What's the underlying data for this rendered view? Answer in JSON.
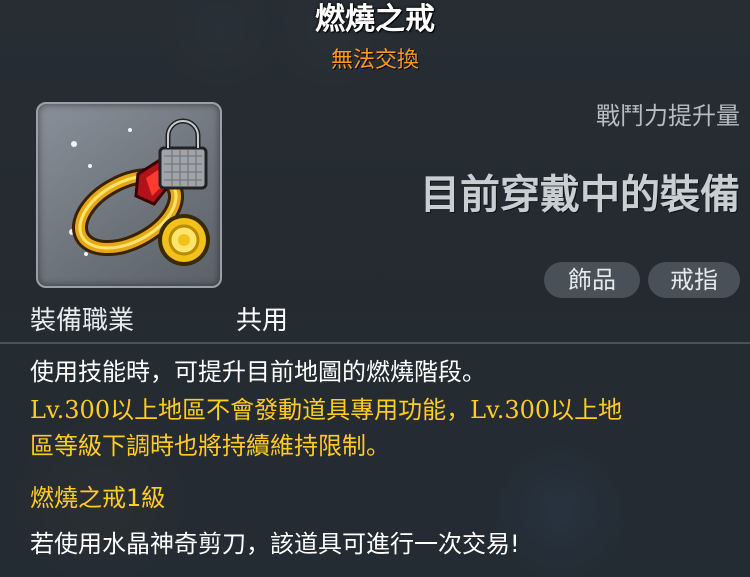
{
  "item": {
    "name": "燃燒之戒",
    "trade_status": "無法交換",
    "icon": "burning-ring-icon",
    "power_label": "戰鬥力提升量",
    "equipped_text": "目前穿戴中的裝備",
    "tags": [
      "飾品",
      "戒指"
    ],
    "job_label": "裝備職業",
    "job_value": "共用",
    "description": "使用技能時，可提升目前地圖的燃燒階段。",
    "notice_line1": "Lv.300以上地區不會發動道具專用功能，Lv.300以上地",
    "notice_line2": "區等級下調時也將持續維持限制。",
    "level_line": "燃燒之戒1級",
    "scissors_line": "若使用水晶神奇剪刀，該道具可進行一次交易!"
  },
  "colors": {
    "title": "#ffffff",
    "trade_status": "#ff9a1f",
    "notice": "#ffcc22",
    "tag_bg": "#4a5058"
  }
}
